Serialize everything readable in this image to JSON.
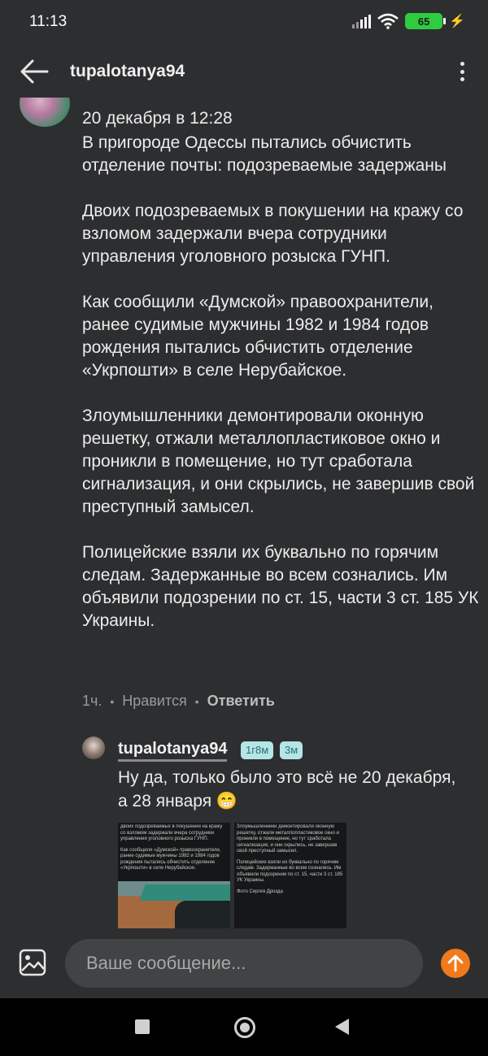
{
  "status_bar": {
    "time": "11:13",
    "battery": "65",
    "icons": [
      "signal-icon",
      "wifi-icon",
      "battery-icon",
      "charging-icon"
    ]
  },
  "header": {
    "title": "tupalotanya94",
    "back_icon": "arrow-left-icon",
    "menu_icon": "more-vertical-icon"
  },
  "post": {
    "date": "20 декабря в 12:28",
    "paragraphs": [
      "В пригороде Одессы пытались обчистить отделение почты: подозреваемые задержаны",
      "Двоих подозреваемых в покушении на кражу со взломом задержали вчера сотрудники управления уголовного розыска ГУНП.",
      "Как сообщили «Думской» правоохранители, ранее судимые мужчины 1982 и 1984 годов рождения пытались обчистить отделение «Укрпошти» в селе Нерубайское.",
      "Злоумышленники демонтировали оконную решетку, отжали металлопластиковое окно и проникли в помещение, но тут сработала сигнализация, и они скрылись, не завершив свой преступный замысел.",
      "Полицейские взяли их буквально по горячим следам. Задержанные во всем сознались. Им объявили подозрении по ст. 15, части 3 ст. 185 УК Украины."
    ],
    "meta": {
      "time": "1ч.",
      "like": "Нравится",
      "reply": "Ответить"
    }
  },
  "reply": {
    "author": "tupalotanya94",
    "badge_1": "1г8м",
    "badge_2": "3м",
    "text": "Ну да, только было это всё не 20 декабря, а 28 января 😁",
    "attachment_1": [
      "двоих подозреваемых в покушении на кражу со взломом задержали вчера сотрудники управления уголовного розыска ГУНП.",
      "Как сообщили «Думской» правоохранители, ранее судимые мужчины 1982 и 1984 годов рождения пытались обчистить отделение «Укрпошти» в селе Нерубайское."
    ],
    "attachment_2": [
      "Злоумышленники демонтировали оконную решетку, отжали металлопластиковое окно и проникли в помещение, но тут сработала сигнализация, и они скрылись, не завершив свой преступный замысел.",
      "Полицейские взяли их буквально по горячим следам. Задержанные во всем сознались. Им объявили подозрении по ст. 15, части 3 ст. 185 УК Украины.",
      "Фото Сергея Дрозда"
    ]
  },
  "composer": {
    "placeholder": "Ваше сообщение...",
    "image_icon": "image-icon",
    "send_icon": "send-arrow-icon"
  },
  "nav_bar": {
    "icons": [
      "recent-apps-icon",
      "home-icon",
      "back-icon"
    ]
  },
  "colors": {
    "background": "#2d2e30",
    "accent": "#f07a1c",
    "battery": "#2ecc40",
    "badge_bg": "#b5e5e5",
    "badge_text": "#2a6f7a"
  }
}
